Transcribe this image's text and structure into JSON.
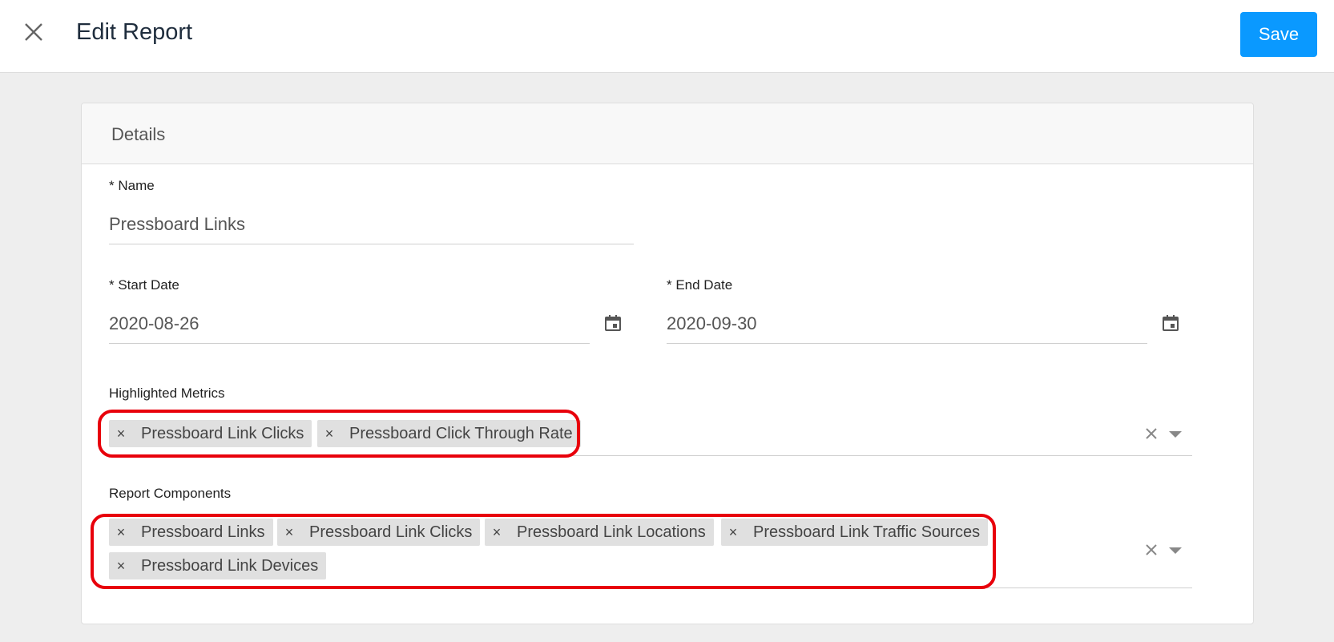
{
  "header": {
    "title": "Edit Report",
    "save_label": "Save"
  },
  "card": {
    "title": "Details"
  },
  "name_field": {
    "label": "* Name",
    "value": "Pressboard Links"
  },
  "start_date": {
    "label": "* Start Date",
    "value": "2020-08-26"
  },
  "end_date": {
    "label": "* End Date",
    "value": "2020-09-30"
  },
  "highlighted_metrics": {
    "label": "Highlighted Metrics",
    "chips": [
      "Pressboard Link Clicks",
      "Pressboard Click Through Rate"
    ]
  },
  "report_components": {
    "label": "Report Components",
    "chips": [
      "Pressboard Links",
      "Pressboard Link Clicks",
      "Pressboard Link Locations",
      "Pressboard Link Traffic Sources",
      "Pressboard Link Devices"
    ]
  },
  "chip_remove_glyph": "×",
  "colors": {
    "accent": "#0a99ff",
    "highlight": "#e8000b",
    "chip_bg": "#e0e0e0"
  },
  "icons": [
    "close-icon",
    "calendar-icon",
    "clear-icon",
    "chevron-down-icon"
  ]
}
